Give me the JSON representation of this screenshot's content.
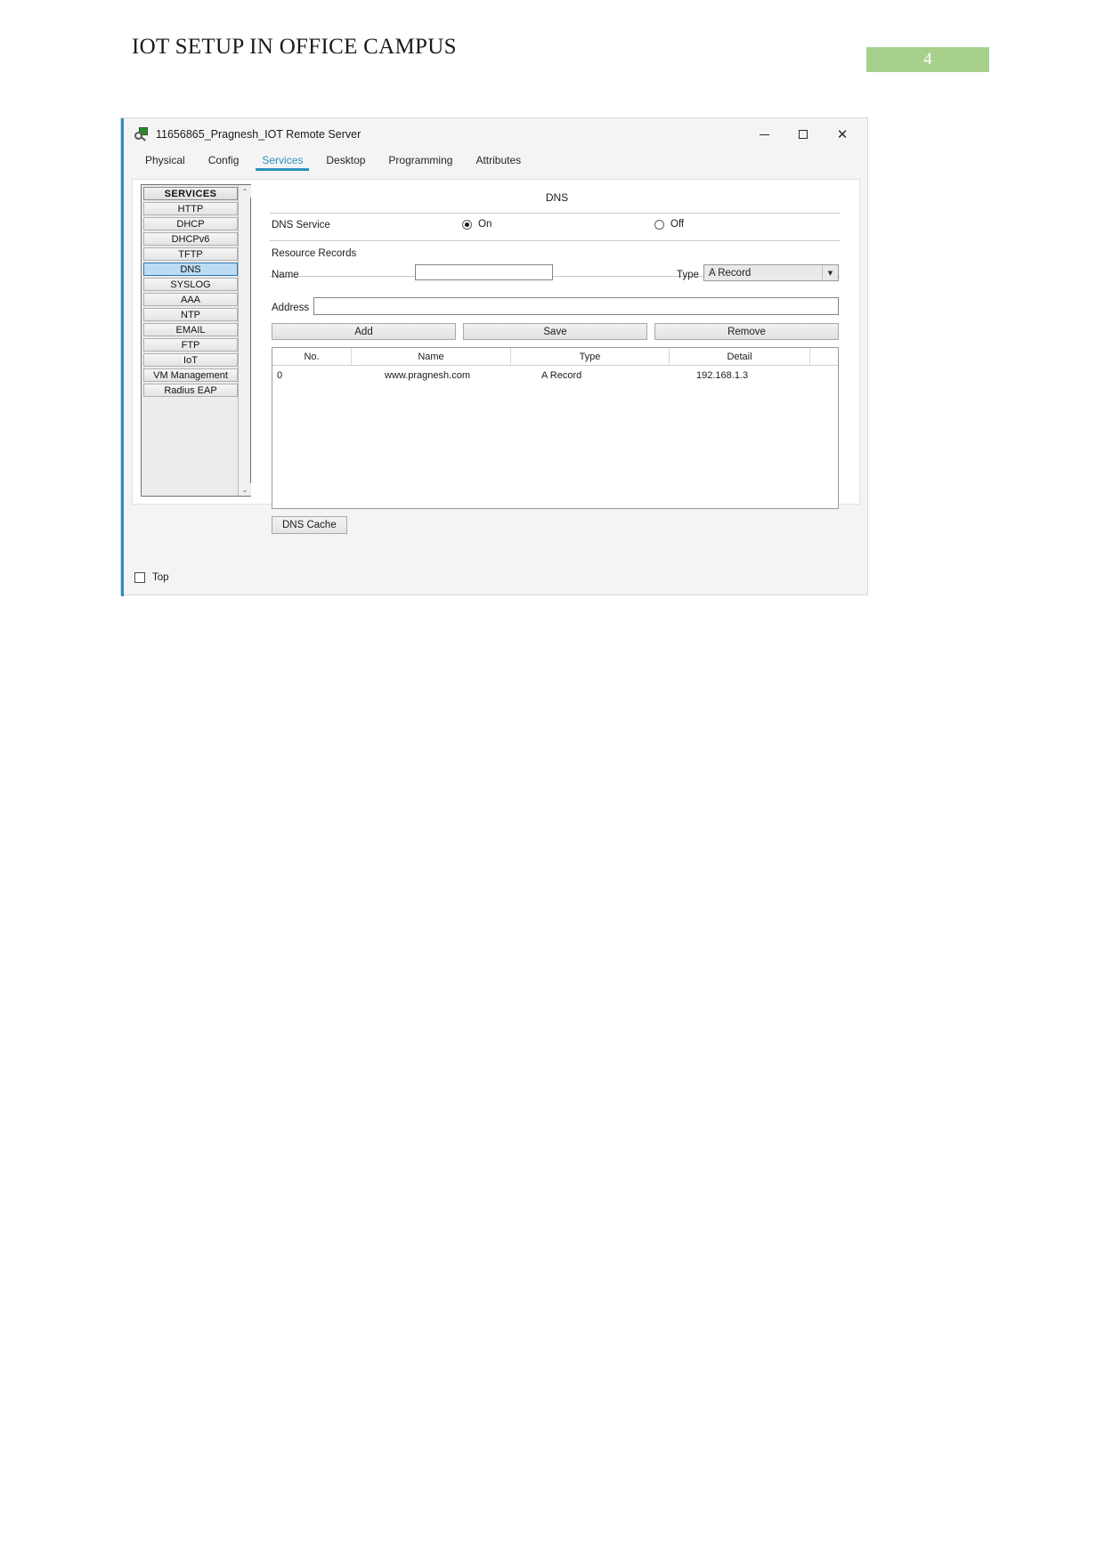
{
  "document": {
    "title": "IOT SETUP IN OFFICE CAMPUS",
    "page_number": "4",
    "badge_color": "#a8d08d"
  },
  "window": {
    "title": "11656865_Pragnesh_IOT Remote Server",
    "icon": "packet-tracer-server-icon",
    "controls": {
      "minimize": "minimize-icon",
      "maximize": "maximize-icon",
      "close": "✕"
    }
  },
  "tabs": [
    {
      "label": "Physical",
      "active": false
    },
    {
      "label": "Config",
      "active": false
    },
    {
      "label": "Services",
      "active": true
    },
    {
      "label": "Desktop",
      "active": false
    },
    {
      "label": "Programming",
      "active": false
    },
    {
      "label": "Attributes",
      "active": false
    }
  ],
  "accent_color": "#2d90bd",
  "sidebar": {
    "header": "SERVICES",
    "items": [
      {
        "label": "HTTP",
        "selected": false
      },
      {
        "label": "DHCP",
        "selected": false
      },
      {
        "label": "DHCPv6",
        "selected": false
      },
      {
        "label": "TFTP",
        "selected": false
      },
      {
        "label": "DNS",
        "selected": true
      },
      {
        "label": "SYSLOG",
        "selected": false
      },
      {
        "label": "AAA",
        "selected": false
      },
      {
        "label": "NTP",
        "selected": false
      },
      {
        "label": "EMAIL",
        "selected": false
      },
      {
        "label": "FTP",
        "selected": false
      },
      {
        "label": "IoT",
        "selected": false
      },
      {
        "label": "VM Management",
        "selected": false
      },
      {
        "label": "Radius EAP",
        "selected": false
      }
    ],
    "scroll_up": "⌃",
    "scroll_down": "⌄"
  },
  "dns": {
    "heading": "DNS",
    "service_label": "DNS Service",
    "radio_on": "On",
    "radio_off": "Off",
    "service_state": "On",
    "resource_records_label": "Resource Records",
    "name_label": "Name",
    "name_value": "",
    "name_placeholder": "",
    "type_label": "Type",
    "type_value": "A Record",
    "type_arrow": "▼",
    "address_label": "Address",
    "address_value": "",
    "address_placeholder": "",
    "buttons": {
      "add": "Add",
      "save": "Save",
      "remove": "Remove",
      "dns_cache": "DNS Cache"
    },
    "table": {
      "columns": [
        "No.",
        "Name",
        "Type",
        "Detail"
      ],
      "rows": [
        {
          "no": "0",
          "name": "www.pragnesh.com",
          "type": "A Record",
          "detail": "192.168.1.3"
        }
      ]
    }
  },
  "footer": {
    "top_label": "Top",
    "top_checked": false
  }
}
